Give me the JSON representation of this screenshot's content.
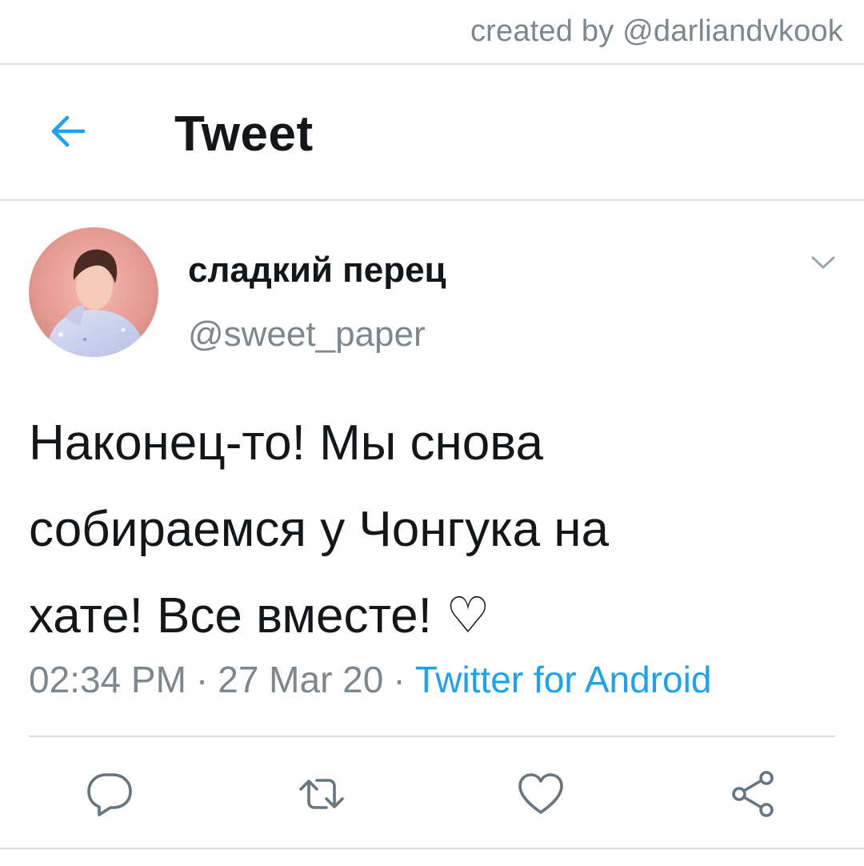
{
  "watermark": {
    "credit": "created by @darliandvkook"
  },
  "header": {
    "title": "Tweet",
    "back_icon": "arrow-left-icon"
  },
  "tweet": {
    "author": {
      "display_name": "сладкий перец",
      "handle": "@sweet_paper",
      "avatar_icon": "avatar-photo"
    },
    "text_lines": [
      "Наконец-то! Мы снова",
      "собираемся у Чонгука на",
      "хате! Все вместе! ♡"
    ],
    "time": "02:34 PM",
    "separator": "·",
    "date": "27 Mar 20",
    "source": "Twitter for Android",
    "menu_icon": "chevron-down-icon"
  },
  "actions": [
    {
      "name": "reply",
      "icon": "comment-icon"
    },
    {
      "name": "retweet",
      "icon": "retweet-icon"
    },
    {
      "name": "like",
      "icon": "heart-icon"
    },
    {
      "name": "share",
      "icon": "share-icon"
    }
  ],
  "colors": {
    "accent": "#1da1f2",
    "secondary_text": "#7c8790",
    "primary_text": "#14171a",
    "divider": "#d7dde2"
  }
}
